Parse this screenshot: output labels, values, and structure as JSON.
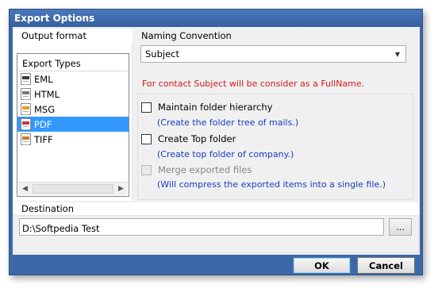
{
  "window": {
    "title": "Export Options"
  },
  "output_format": {
    "group_label": "Output format",
    "list_header": "Export Types",
    "items": [
      {
        "label": "EML",
        "icon": "eml-file-icon",
        "selected": false
      },
      {
        "label": "HTML",
        "icon": "html-file-icon",
        "selected": false
      },
      {
        "label": "MSG",
        "icon": "msg-file-icon",
        "selected": false
      },
      {
        "label": "PDF",
        "icon": "pdf-file-icon",
        "selected": true
      },
      {
        "label": "TIFF",
        "icon": "tiff-file-icon",
        "selected": false
      }
    ],
    "scroll_left": "◀",
    "scroll_right": "▶"
  },
  "naming": {
    "label": "Naming Convention",
    "selected": "Subject",
    "caret": "▼",
    "note": "For contact Subject will be consider as a FullName."
  },
  "options": [
    {
      "label": "Maintain folder hierarchy",
      "desc": "(Create the folder tree of mails.)",
      "checked": false,
      "enabled": true
    },
    {
      "label": "Create Top folder",
      "desc": "(Create top folder of company.)",
      "checked": false,
      "enabled": true
    },
    {
      "label": "Merge exported files",
      "desc": "(Will compress the exported items into a single file.)",
      "checked": false,
      "enabled": false
    }
  ],
  "destination": {
    "label": "Destination",
    "path": "D:\\Softpedia Test",
    "browse_label": "..."
  },
  "buttons": {
    "ok": "OK",
    "cancel": "Cancel"
  },
  "colors": {
    "title_bar": "#3b68a8",
    "selection": "#3399ff",
    "note_red": "#d21a1a",
    "desc_blue": "#1a3cc4"
  }
}
